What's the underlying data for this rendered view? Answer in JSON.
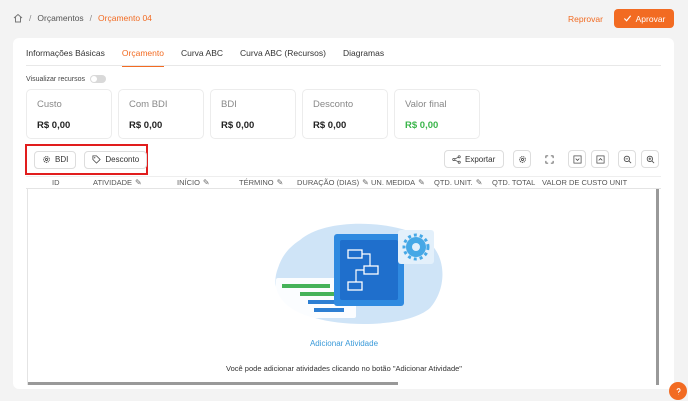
{
  "breadcrumb": {
    "items": [
      "Orçamentos",
      "Orçamento 04"
    ]
  },
  "header": {
    "reject_label": "Reprovar",
    "approve_label": "Aprovar"
  },
  "tabs": [
    {
      "label": "Informações Básicas"
    },
    {
      "label": "Orçamento"
    },
    {
      "label": "Curva ABC"
    },
    {
      "label": "Curva ABC (Recursos)"
    },
    {
      "label": "Diagramas"
    }
  ],
  "toggle": {
    "label": "Visualizar recursos",
    "on": false
  },
  "stats": [
    {
      "label": "Custo",
      "value": "R$ 0,00"
    },
    {
      "label": "Com BDI",
      "value": "R$ 0,00"
    },
    {
      "label": "BDI",
      "value": "R$ 0,00"
    },
    {
      "label": "Desconto",
      "value": "R$ 0,00"
    },
    {
      "label": "Valor final",
      "value": "R$ 0,00"
    }
  ],
  "toolbar": {
    "bdi_label": "BDI",
    "discount_label": "Desconto",
    "export_label": "Exportar"
  },
  "table": {
    "columns": [
      "ID",
      "ATIVIDADE",
      "INÍCIO",
      "TÉRMINO",
      "DURAÇÃO (DIAS)",
      "UN. MEDIDA",
      "QTD. UNIT.",
      "QTD. TOTAL",
      "VALOR DE CUSTO UNIT"
    ]
  },
  "empty_state": {
    "add_label": "Adicionar Atividade",
    "hint": "Você pode adicionar atividades clicando no botão \"Adicionar Atividade\""
  },
  "colors": {
    "accent": "#f26b22",
    "link": "#3a9ad9",
    "success": "#3ab54a",
    "highlight": "#e11d1d"
  },
  "icons": [
    "home-icon",
    "check-icon",
    "gear-icon",
    "tag-icon",
    "share-icon",
    "expand-icon",
    "collapse-down-icon",
    "collapse-up-icon",
    "zoom-out-icon",
    "zoom-in-icon",
    "pencil-icon",
    "help-icon"
  ]
}
